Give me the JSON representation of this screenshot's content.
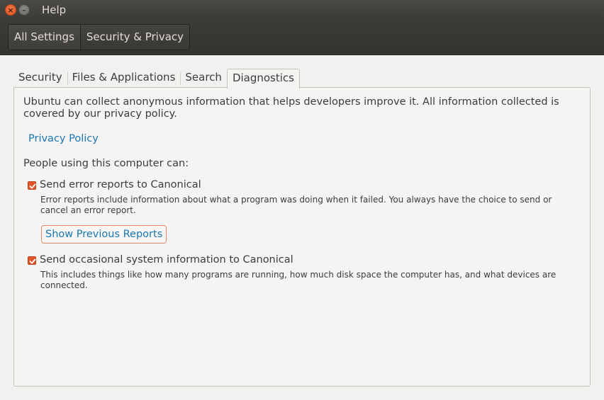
{
  "window": {
    "title": "Help",
    "close_glyph": "×",
    "minimize_glyph": "–"
  },
  "toolbar": {
    "breadcrumbs": [
      {
        "label": "All Settings"
      },
      {
        "label": "Security & Privacy"
      }
    ]
  },
  "tabs": [
    {
      "label": "Security"
    },
    {
      "label": "Files & Applications"
    },
    {
      "label": "Search"
    },
    {
      "label": "Diagnostics",
      "active": true
    }
  ],
  "diagnostics": {
    "intro": "Ubuntu can collect anonymous information that helps developers improve it. All information collected is covered by our privacy policy.",
    "privacy_link": "Privacy Policy",
    "people_label": "People using this computer can:",
    "options": [
      {
        "label": "Send error reports to Canonical",
        "checked": true,
        "description": "Error reports include information about what a program was doing when it failed. You always have the choice to send or cancel an error report."
      },
      {
        "label": "Send occasional system information to Canonical",
        "checked": true,
        "description": "This includes things like how many programs are running, how much disk space the computer has, and what devices are connected."
      }
    ],
    "show_reports_button": "Show Previous Reports"
  },
  "colors": {
    "accent": "#e0562a",
    "link": "#1977b3",
    "titlebar": "#3c3b37"
  },
  "icons": {
    "close": "close-icon",
    "minimize": "minimize-icon",
    "checkbox": "checkmark-icon"
  }
}
